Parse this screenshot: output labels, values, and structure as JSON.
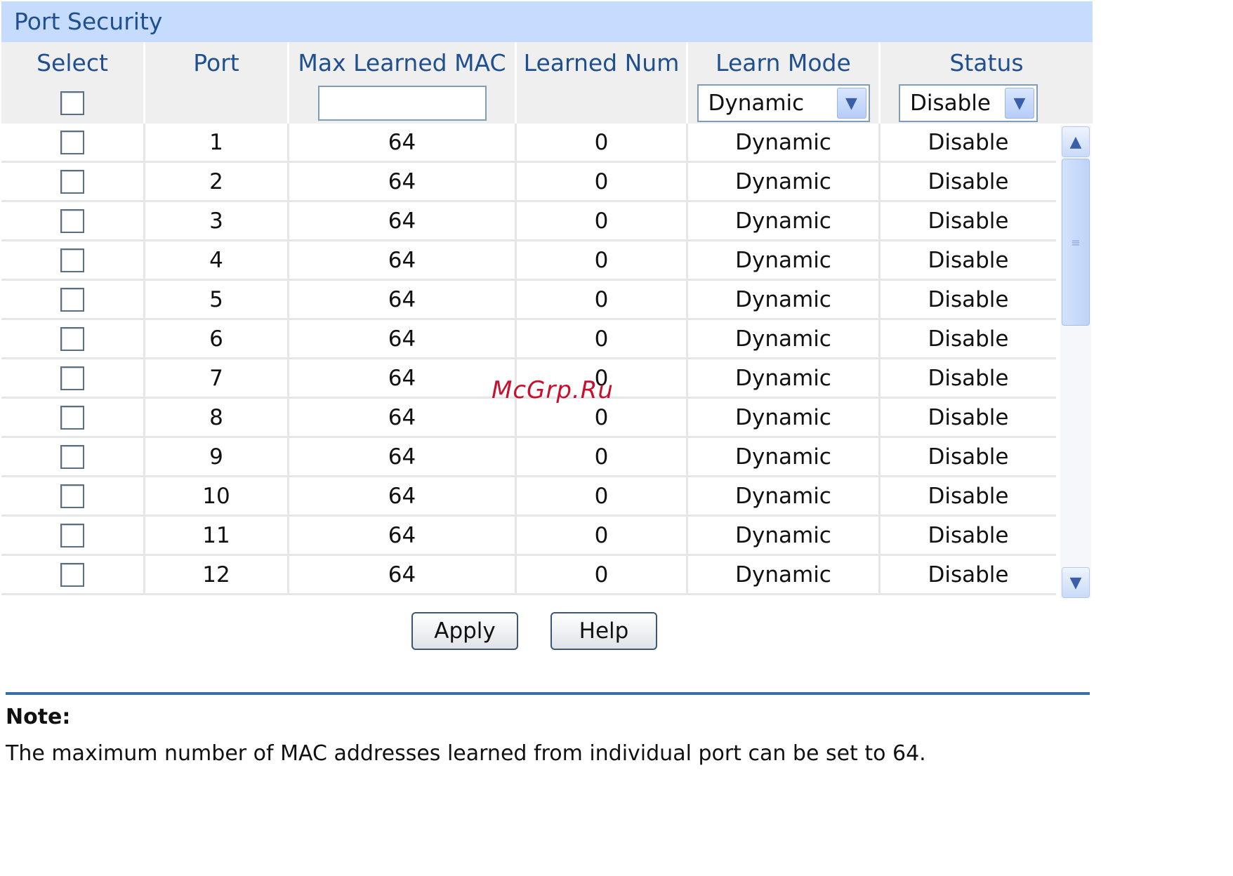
{
  "panel": {
    "title": "Port Security"
  },
  "columns": [
    "Select",
    "Port",
    "Max Learned MAC",
    "Learned Num",
    "Learn Mode",
    "Status"
  ],
  "controls": {
    "max_learned_value": "",
    "learn_mode_selected": "Dynamic",
    "status_selected": "Disable"
  },
  "rows": [
    {
      "port": "1",
      "max": "64",
      "learned": "0",
      "mode": "Dynamic",
      "status": "Disable"
    },
    {
      "port": "2",
      "max": "64",
      "learned": "0",
      "mode": "Dynamic",
      "status": "Disable"
    },
    {
      "port": "3",
      "max": "64",
      "learned": "0",
      "mode": "Dynamic",
      "status": "Disable"
    },
    {
      "port": "4",
      "max": "64",
      "learned": "0",
      "mode": "Dynamic",
      "status": "Disable"
    },
    {
      "port": "5",
      "max": "64",
      "learned": "0",
      "mode": "Dynamic",
      "status": "Disable"
    },
    {
      "port": "6",
      "max": "64",
      "learned": "0",
      "mode": "Dynamic",
      "status": "Disable"
    },
    {
      "port": "7",
      "max": "64",
      "learned": "0",
      "mode": "Dynamic",
      "status": "Disable"
    },
    {
      "port": "8",
      "max": "64",
      "learned": "0",
      "mode": "Dynamic",
      "status": "Disable"
    },
    {
      "port": "9",
      "max": "64",
      "learned": "0",
      "mode": "Dynamic",
      "status": "Disable"
    },
    {
      "port": "10",
      "max": "64",
      "learned": "0",
      "mode": "Dynamic",
      "status": "Disable"
    },
    {
      "port": "11",
      "max": "64",
      "learned": "0",
      "mode": "Dynamic",
      "status": "Disable"
    },
    {
      "port": "12",
      "max": "64",
      "learned": "0",
      "mode": "Dynamic",
      "status": "Disable"
    }
  ],
  "buttons": {
    "apply": "Apply",
    "help": "Help"
  },
  "note": {
    "title": "Note:",
    "text": "The maximum number of MAC addresses learned from individual port can be set to 64."
  },
  "watermark": "McGrp.Ru",
  "colors": {
    "header_bg": "#c6dcff",
    "header_text": "#1f4f8f",
    "rule": "#3a6fa5",
    "watermark": "#c8102e"
  }
}
